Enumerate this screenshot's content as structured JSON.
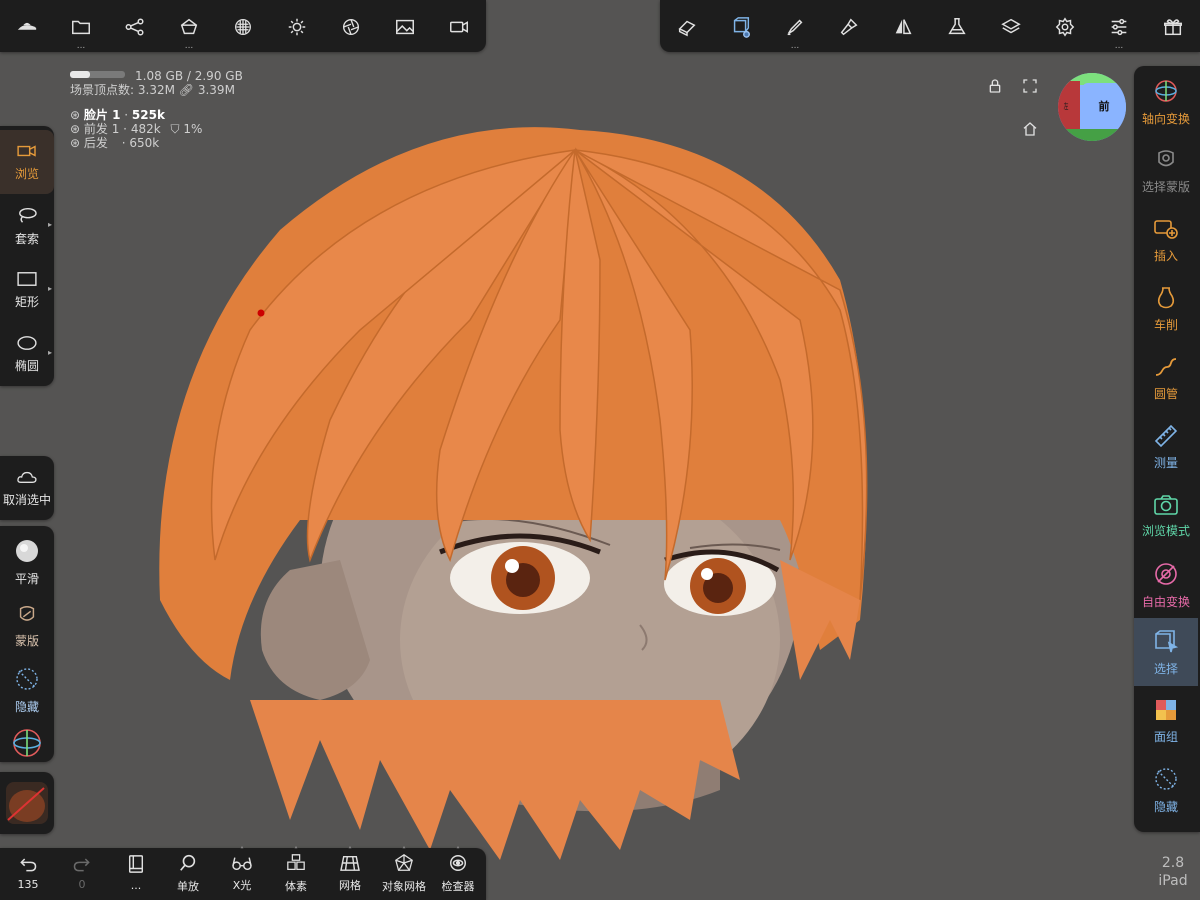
{
  "top_left_toolbar": {
    "items": [
      {
        "name": "app-logo-icon",
        "dots": ""
      },
      {
        "name": "folder-icon",
        "dots": "..."
      },
      {
        "name": "share-graph-icon",
        "dots": ""
      },
      {
        "name": "scene-object-icon",
        "dots": "..."
      },
      {
        "name": "material-sphere-icon",
        "dots": ""
      },
      {
        "name": "light-sun-icon",
        "dots": ""
      },
      {
        "name": "camera-aperture-icon",
        "dots": ""
      },
      {
        "name": "image-icon",
        "dots": ""
      },
      {
        "name": "video-camera-icon",
        "dots": ""
      }
    ]
  },
  "top_right_toolbar": {
    "items": [
      {
        "name": "eraser-icon",
        "dots": ""
      },
      {
        "name": "select-box-icon",
        "dots": "",
        "active": true
      },
      {
        "name": "pen-icon",
        "dots": "..."
      },
      {
        "name": "brush-icon",
        "dots": ""
      },
      {
        "name": "symmetry-icon",
        "dots": ""
      },
      {
        "name": "flask-icon",
        "dots": ""
      },
      {
        "name": "layers-icon",
        "dots": ""
      },
      {
        "name": "settings-gear-icon",
        "dots": ""
      },
      {
        "name": "sliders-icon",
        "dots": "..."
      },
      {
        "name": "gift-icon",
        "dots": ""
      }
    ]
  },
  "stats": {
    "memory": "1.08 GB / 2.90 GB",
    "memory_fraction": 0.37,
    "vertices_label": "场景顶点数:",
    "vertices": "3.32M",
    "links": "3.39M"
  },
  "objects": [
    {
      "name": "脸片 1",
      "count": "525k",
      "extra": ""
    },
    {
      "name": "前发 1",
      "count": "482k",
      "extra": "1%"
    },
    {
      "name": "后发",
      "count": "650k",
      "extra": ""
    }
  ],
  "view_cube": {
    "face_label": "前",
    "side_label": "左"
  },
  "left_tools": {
    "group1": [
      {
        "label": "浏览",
        "name": "browse-tool",
        "icon": "video-camera-icon",
        "active": true
      },
      {
        "label": "套索",
        "name": "lasso-tool",
        "icon": "lasso-icon"
      },
      {
        "label": "矩形",
        "name": "rectangle-tool",
        "icon": "rectangle-icon"
      },
      {
        "label": "椭圆",
        "name": "ellipse-tool",
        "icon": "ellipse-icon"
      }
    ],
    "deselect_label": "取消选中",
    "group2": [
      {
        "label": "平滑",
        "name": "smooth-tool",
        "icon": "smooth-icon"
      },
      {
        "label": "蒙版",
        "name": "mask-tool",
        "icon": "mask-icon"
      },
      {
        "label": "隐藏",
        "name": "hide-tool",
        "icon": "hide-icon"
      }
    ]
  },
  "right_tools": [
    {
      "label": "轴向变换",
      "name": "axis-transform",
      "icon": "gizmo-icon",
      "color": "#e59a3a"
    },
    {
      "label": "选择蒙版",
      "name": "select-mask",
      "icon": "mask-icon",
      "color": "#8a8a8a"
    },
    {
      "label": "插入",
      "name": "insert",
      "icon": "insert-icon",
      "color": "#e59a3a"
    },
    {
      "label": "车削",
      "name": "lathe",
      "icon": "vase-icon",
      "color": "#e59a3a"
    },
    {
      "label": "圆管",
      "name": "tube",
      "icon": "tube-icon",
      "color": "#e59a3a"
    },
    {
      "label": "测量",
      "name": "measure",
      "icon": "ruler-icon",
      "color": "#7fb3e6"
    },
    {
      "label": "浏览模式",
      "name": "view-mode",
      "icon": "camera-icon",
      "color": "#5fd6a8"
    },
    {
      "label": "自由变换",
      "name": "free-transform",
      "icon": "transform-icon",
      "color": "#e66aa8"
    },
    {
      "label": "选择",
      "name": "select",
      "icon": "select-box-icon",
      "color": "#7fb3e6",
      "active": true
    },
    {
      "label": "面组",
      "name": "face-group",
      "icon": "facegroup-icon",
      "color": "#7fb3e6"
    },
    {
      "label": "隐藏",
      "name": "hide",
      "icon": "hide-icon",
      "color": "#7fb3e6"
    }
  ],
  "bottom_toolbar": {
    "undo_count": "135",
    "redo_count": "0",
    "items": [
      {
        "label": "...",
        "name": "book-icon"
      },
      {
        "label": "单放",
        "name": "search-icon"
      },
      {
        "label": "X光",
        "name": "xray-icon"
      },
      {
        "label": "体素",
        "name": "voxel-icon"
      },
      {
        "label": "网格",
        "name": "grid-icon"
      },
      {
        "label": "对象网格",
        "name": "object-mesh-icon"
      },
      {
        "label": "检查器",
        "name": "inspector-icon"
      }
    ]
  },
  "version": {
    "number": "2.8",
    "device": "iPad"
  }
}
